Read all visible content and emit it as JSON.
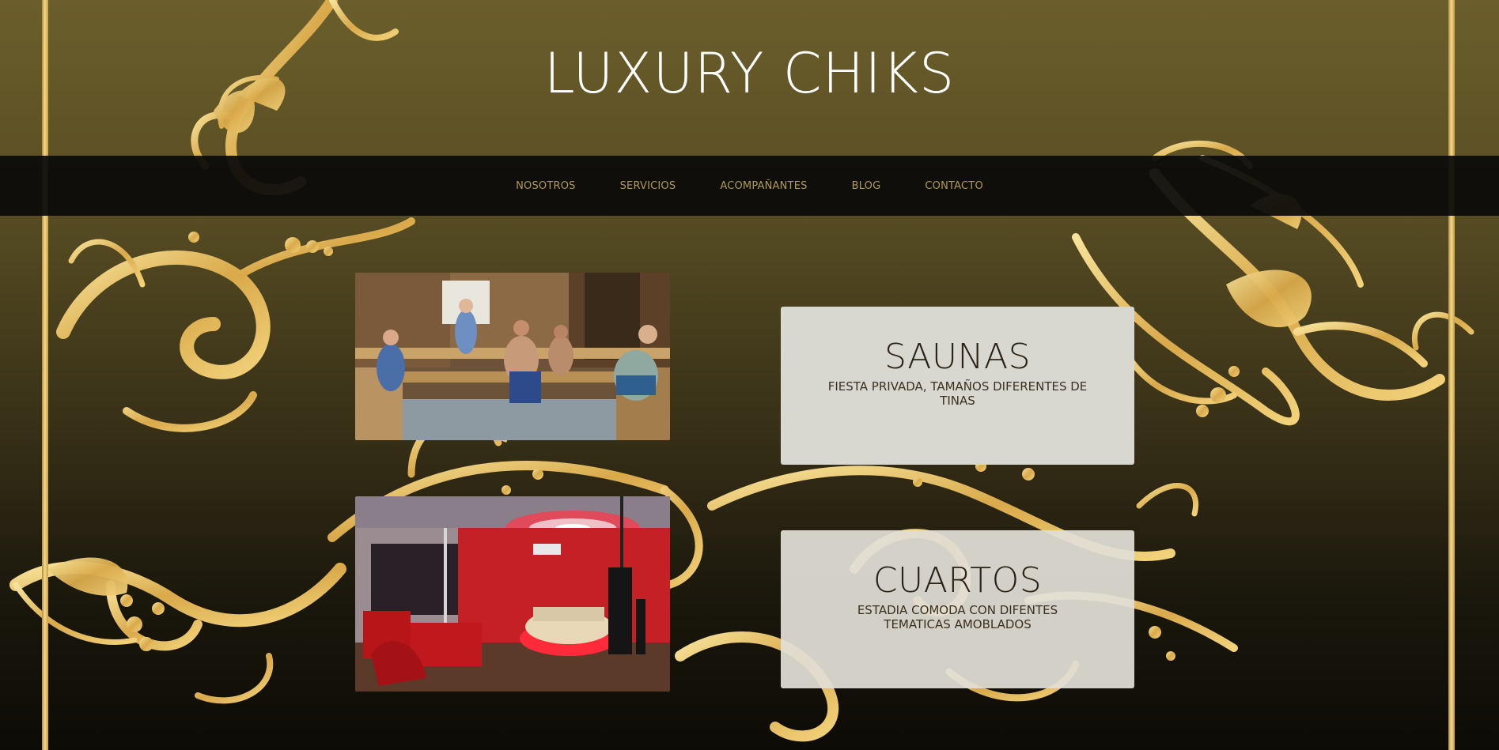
{
  "site": {
    "title": "LUXURY CHIKS"
  },
  "nav": {
    "items": [
      {
        "label": "NOSOTROS"
      },
      {
        "label": "SERVICIOS"
      },
      {
        "label": "ACOMPAÑANTES"
      },
      {
        "label": "BLOG"
      },
      {
        "label": "CONTACTO"
      }
    ]
  },
  "services": [
    {
      "title": "SAUNAS",
      "description": "FIESTA PRIVADA, TAMAÑOS DIFERENTES DE TINAS",
      "image": "sauna-photo"
    },
    {
      "title": "CUARTOS",
      "description": "ESTADIA COMODA CON DIFENTES TEMATICAS AMOBLADOS",
      "image": "room-photo"
    }
  ],
  "colors": {
    "background_top": "#6b5e2c",
    "background_bottom": "#0d0b06",
    "gold": "#e6c46a",
    "nav_background": "#0a0a0a",
    "nav_text": "#b09950",
    "card_background": "#d8d7d0",
    "card_text": "#2a2215"
  }
}
